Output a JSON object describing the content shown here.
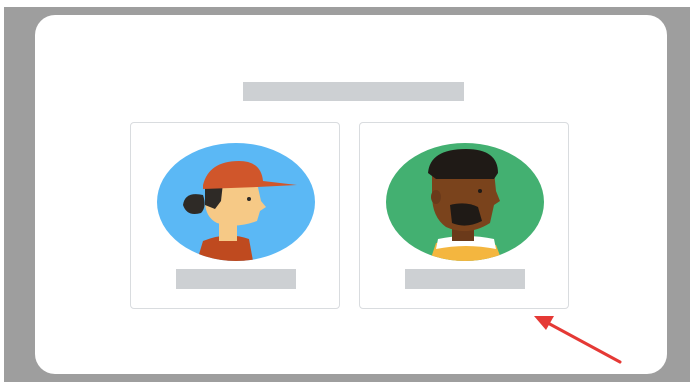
{
  "dialog": {
    "title": "",
    "accounts": [
      {
        "name": "",
        "avatar": "woman-with-cap-avatar"
      },
      {
        "name": "",
        "avatar": "man-avatar"
      }
    ]
  },
  "annotation": {
    "arrow_icon": "red-arrow-icon",
    "color": "#e53935"
  },
  "colors": {
    "frame": "#9e9e9e",
    "placeholder": "#cdd0d3",
    "avatar_left_bg": "#5bb8f5",
    "avatar_right_bg": "#43b071"
  }
}
